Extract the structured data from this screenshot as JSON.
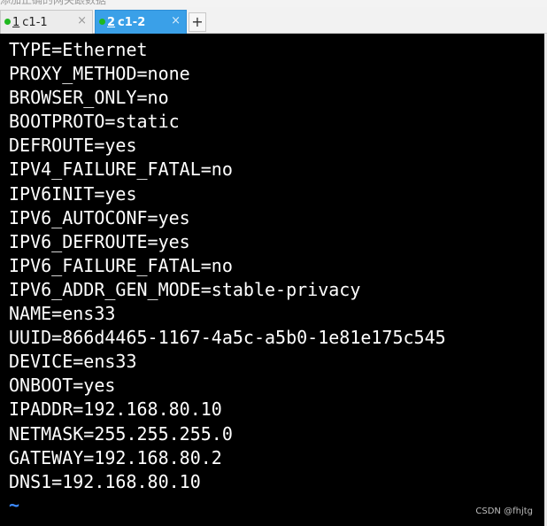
{
  "top_strip": {
    "text": "添加正确的网关跟数据"
  },
  "tabs": [
    {
      "number": "1",
      "label": "c1-1",
      "status_color": "#1fb81f",
      "active": false
    },
    {
      "number": "2",
      "label": "c1-2",
      "status_color": "#1fb81f",
      "active": true
    }
  ],
  "new_tab_label": "+",
  "close_glyph": "×",
  "terminal": {
    "lines": [
      "TYPE=Ethernet",
      "PROXY_METHOD=none",
      "BROWSER_ONLY=no",
      "BOOTPROTO=static",
      "DEFROUTE=yes",
      "IPV4_FAILURE_FATAL=no",
      "IPV6INIT=yes",
      "IPV6_AUTOCONF=yes",
      "IPV6_DEFROUTE=yes",
      "IPV6_FAILURE_FATAL=no",
      "IPV6_ADDR_GEN_MODE=stable-privacy",
      "NAME=ens33",
      "UUID=866d4465-1167-4a5c-a5b0-1e81e175c545",
      "DEVICE=ens33",
      "ONBOOT=yes",
      "IPADDR=192.168.80.10",
      "NETMASK=255.255.255.0",
      "GATEWAY=192.168.80.2",
      "DNS1=192.168.80.10"
    ],
    "empty_line_marker": "~"
  },
  "annotation": {
    "color": "#e31515"
  },
  "watermark": "CSDN @fhjtg"
}
